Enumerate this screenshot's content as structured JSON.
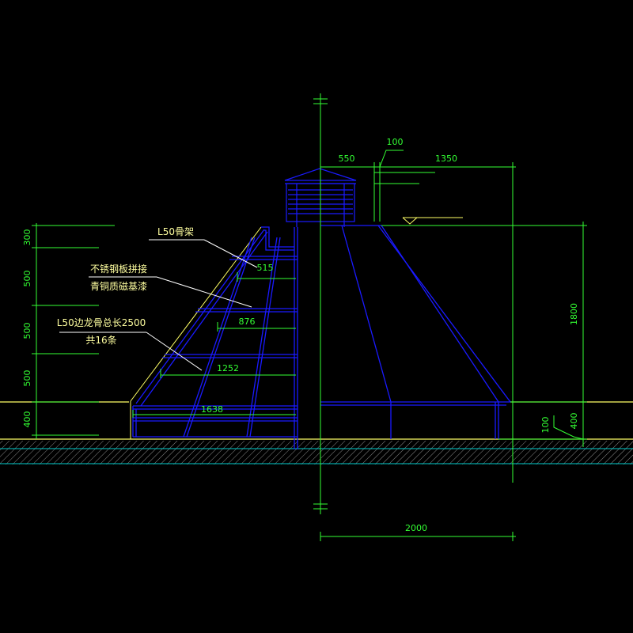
{
  "colors": {
    "background": "#000000",
    "structure": "#1a1aff",
    "dimension": "#33ff33",
    "annotation_text": "#ffffa0",
    "leader": "#ffffff",
    "ground_line": "#ffff66",
    "ground_hatch": "#8a8a8a",
    "ground_band": "#00cccc"
  },
  "dimensions": {
    "left_heights": [
      "300",
      "500",
      "500",
      "500",
      "400"
    ],
    "inner_widths": [
      "515",
      "876",
      "1252",
      "1638"
    ],
    "top_left": "550",
    "top_gap": "100",
    "top_right": "1350",
    "total_height": "1800",
    "base_height": "400",
    "ground_offset": "100",
    "bottom_width": "2000"
  },
  "annotations": {
    "frame": "L50骨架",
    "cladding_line1": "不锈钢板拼接",
    "cladding_line2": "青铜质磁基漆",
    "keel_line1": "L50边龙骨总长2500",
    "keel_line2": "共16条"
  }
}
